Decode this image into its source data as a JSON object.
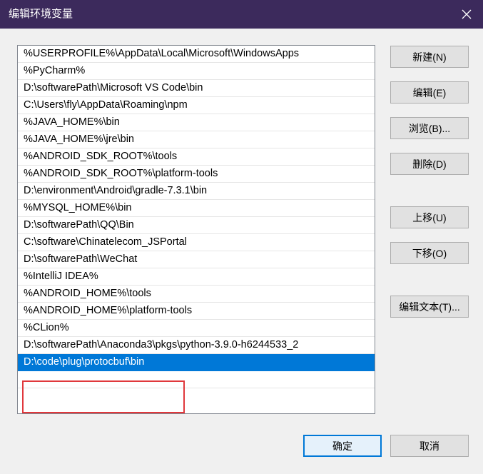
{
  "window": {
    "title": "编辑环境变量"
  },
  "paths": [
    "%USERPROFILE%\\AppData\\Local\\Microsoft\\WindowsApps",
    "%PyCharm%",
    "D:\\softwarePath\\Microsoft VS Code\\bin",
    "C:\\Users\\fly\\AppData\\Roaming\\npm",
    "%JAVA_HOME%\\bin",
    "%JAVA_HOME%\\jre\\bin",
    "%ANDROID_SDK_ROOT%\\tools",
    "%ANDROID_SDK_ROOT%\\platform-tools",
    "D:\\environment\\Android\\gradle-7.3.1\\bin",
    "%MYSQL_HOME%\\bin",
    "D:\\softwarePath\\QQ\\Bin",
    "C:\\software\\Chinatelecom_JSPortal",
    "D:\\softwarePath\\WeChat",
    "%IntelliJ IDEA%",
    "%ANDROID_HOME%\\tools",
    "%ANDROID_HOME%\\platform-tools",
    "%CLion%",
    "D:\\softwarePath\\Anaconda3\\pkgs\\python-3.9.0-h6244533_2",
    "D:\\code\\plug\\protocbuf\\bin"
  ],
  "selected_index": 18,
  "buttons": {
    "new": "新建(N)",
    "edit": "编辑(E)",
    "browse": "浏览(B)...",
    "delete": "删除(D)",
    "move_up": "上移(U)",
    "move_down": "下移(O)",
    "edit_text": "编辑文本(T)...",
    "ok": "确定",
    "cancel": "取消"
  },
  "colors": {
    "titlebar": "#3c2a5c",
    "selection": "#0078d7",
    "annotation": "#e0383c"
  }
}
